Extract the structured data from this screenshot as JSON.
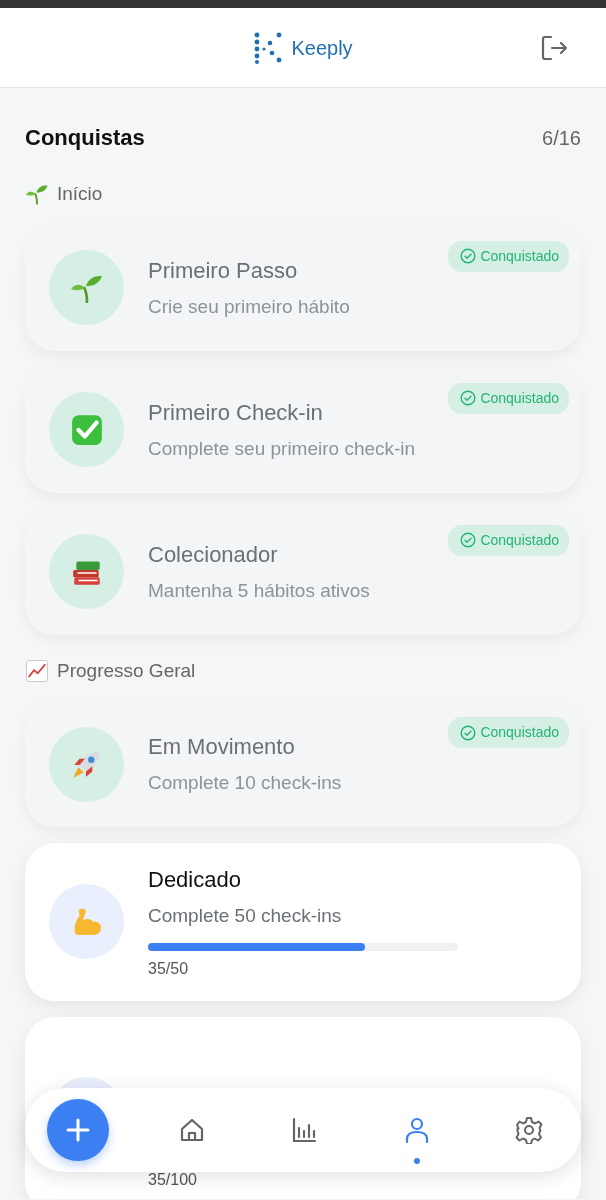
{
  "header": {
    "brand": "Keeply"
  },
  "page": {
    "title": "Conquistas",
    "count": "6/16"
  },
  "sections": [
    {
      "title": "Início",
      "achievements": [
        {
          "title": "Primeiro Passo",
          "description": "Crie seu primeiro hábito",
          "earned": true,
          "badge": "Conquistado"
        },
        {
          "title": "Primeiro Check-in",
          "description": "Complete seu primeiro check-in",
          "earned": true,
          "badge": "Conquistado"
        },
        {
          "title": "Colecionador",
          "description": "Mantenha 5 hábitos ativos",
          "earned": true,
          "badge": "Conquistado"
        }
      ]
    },
    {
      "title": "Progresso Geral",
      "achievements": [
        {
          "title": "Em Movimento",
          "description": "Complete 10 check-ins",
          "earned": true,
          "badge": "Conquistado"
        },
        {
          "title": "Dedicado",
          "description": "Complete 50 check-ins",
          "earned": false,
          "level": 0.7,
          "reading": "35/50"
        },
        {
          "earned": false,
          "reading": "35/100"
        }
      ]
    }
  ],
  "nav": {
    "items": [
      {
        "kind": "add",
        "selected": false
      },
      {
        "kind": "home",
        "selected": false
      },
      {
        "kind": "stats",
        "selected": false
      },
      {
        "kind": "profile",
        "selected": true
      },
      {
        "kind": "settings",
        "selected": false
      }
    ]
  }
}
